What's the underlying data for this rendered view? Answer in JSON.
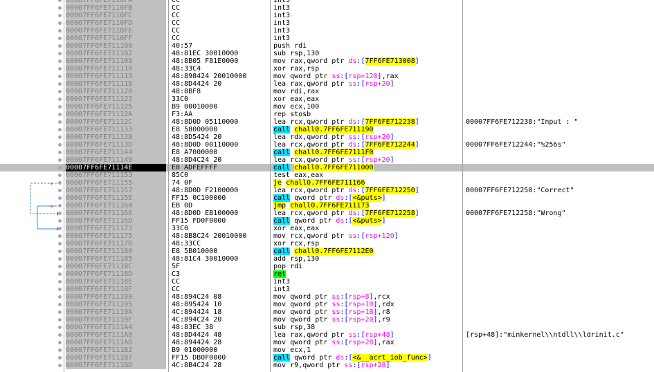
{
  "rows": [
    {
      "a": "00007FF6FE7110FA",
      "b": "CC",
      "i": [
        [
          "int3",
          ""
        ]
      ],
      "c": ""
    },
    {
      "a": "00007FF6FE7110FB",
      "b": "CC",
      "i": [
        [
          "int3",
          ""
        ]
      ],
      "c": ""
    },
    {
      "a": "00007FF6FE7110FC",
      "b": "CC",
      "i": [
        [
          "int3",
          ""
        ]
      ],
      "c": ""
    },
    {
      "a": "00007FF6FE7110FD",
      "b": "CC",
      "i": [
        [
          "int3",
          ""
        ]
      ],
      "c": ""
    },
    {
      "a": "00007FF6FE7110FE",
      "b": "CC",
      "i": [
        [
          "int3",
          ""
        ]
      ],
      "c": ""
    },
    {
      "a": "00007FF6FE7110FF",
      "b": "CC",
      "i": [
        [
          "int3",
          ""
        ]
      ],
      "c": ""
    },
    {
      "a": "00007FF6FE711100",
      "b": "40:57",
      "i": [
        [
          "push rdi",
          ""
        ]
      ],
      "c": ""
    },
    {
      "a": "00007FF6FE711102",
      "b": "48:81EC 30010000",
      "i": [
        [
          "sub rsp,130",
          ""
        ]
      ],
      "c": ""
    },
    {
      "a": "00007FF6FE711109",
      "b": "48:8B05 F81E0000",
      "i": [
        [
          "mov rax,qword ptr ",
          ""
        ],
        [
          "ds",
          "seg"
        ],
        [
          ":[",
          "bk"
        ],
        [
          "7FF6FE713008",
          "ylw"
        ],
        [
          "]",
          "bk"
        ]
      ],
      "c": ""
    },
    {
      "a": "00007FF6FE711110",
      "b": "48:33C4",
      "i": [
        [
          "xor rax,rsp",
          ""
        ]
      ],
      "c": ""
    },
    {
      "a": "00007FF6FE711113",
      "b": "48:898424 20010000",
      "i": [
        [
          "mov qword ptr ",
          ""
        ],
        [
          "ss",
          "seg"
        ],
        [
          ":[",
          "bk"
        ],
        [
          "rsp+120",
          "seg"
        ],
        [
          "]",
          "bk"
        ],
        [
          ",rax",
          ""
        ]
      ],
      "c": ""
    },
    {
      "a": "00007FF6FE71111B",
      "b": "48:8D4424 20",
      "i": [
        [
          "lea rax,qword ptr ",
          ""
        ],
        [
          "ss",
          "seg"
        ],
        [
          ":[",
          "bk"
        ],
        [
          "rsp+20",
          "seg"
        ],
        [
          "]",
          "bk"
        ]
      ],
      "c": ""
    },
    {
      "a": "00007FF6FE711120",
      "b": "48:8BF8",
      "i": [
        [
          "mov rdi,rax",
          ""
        ]
      ],
      "c": ""
    },
    {
      "a": "00007FF6FE711123",
      "b": "33C0",
      "i": [
        [
          "xor eax,eax",
          ""
        ]
      ],
      "c": ""
    },
    {
      "a": "00007FF6FE711125",
      "b": "B9 00010000",
      "i": [
        [
          "mov ecx,100",
          ""
        ]
      ],
      "c": ""
    },
    {
      "a": "00007FF6FE71112A",
      "b": "F3:AA",
      "i": [
        [
          "rep stosb",
          ""
        ]
      ],
      "c": ""
    },
    {
      "a": "00007FF6FE71112C",
      "b": "48:8D0D 05110000",
      "i": [
        [
          "lea rcx,qword ptr ",
          ""
        ],
        [
          "ds",
          "seg"
        ],
        [
          ":[",
          "bk"
        ],
        [
          "7FF6FE712238",
          "ylw"
        ],
        [
          "]",
          "bk"
        ]
      ],
      "c": "00007FF6FE712238:\"Input : \""
    },
    {
      "a": "00007FF6FE711133",
      "b": "E8 58000000",
      "i": [
        [
          "call",
          "call"
        ],
        [
          " ",
          ""
        ],
        [
          "chall0.7FF6FE711190",
          "ylw"
        ]
      ],
      "c": ""
    },
    {
      "a": "00007FF6FE711138",
      "b": "48:8D5424 20",
      "i": [
        [
          "lea rdx,qword ptr ",
          ""
        ],
        [
          "ss",
          "seg"
        ],
        [
          ":[",
          "bk"
        ],
        [
          "rsp+20",
          "seg"
        ],
        [
          "]",
          "bk"
        ]
      ],
      "c": ""
    },
    {
      "a": "00007FF6FE71113D",
      "b": "48:8D0D 00110000",
      "i": [
        [
          "lea rcx,qword ptr ",
          ""
        ],
        [
          "ds",
          "seg"
        ],
        [
          ":[",
          "bk"
        ],
        [
          "7FF6FE712244",
          "ylw"
        ],
        [
          "]",
          "bk"
        ]
      ],
      "c": "00007FF6FE712244:\"%256s\""
    },
    {
      "a": "00007FF6FE711144",
      "b": "E8 A7000000",
      "i": [
        [
          "call",
          "call"
        ],
        [
          " ",
          ""
        ],
        [
          "chall0.7FF6FE7111F0",
          "ylw"
        ]
      ],
      "c": ""
    },
    {
      "a": "00007FF6FE711149",
      "b": "48:8D4C24 20",
      "i": [
        [
          "lea rcx,qword ptr ",
          ""
        ],
        [
          "ss",
          "seg"
        ],
        [
          ":[",
          "bk"
        ],
        [
          "rsp+20",
          "seg"
        ],
        [
          "]",
          "bk"
        ]
      ],
      "c": ""
    },
    {
      "a": "00007FF6FE71114E",
      "b": "E8 ADFEFFFF",
      "i": [
        [
          "call",
          "call"
        ],
        [
          " ",
          ""
        ],
        [
          "chall0.7FF6FE711000",
          "ylw"
        ]
      ],
      "c": "",
      "sel": true
    },
    {
      "a": "00007FF6FE711153",
      "b": "85C0",
      "i": [
        [
          "test eax,eax",
          ""
        ]
      ],
      "c": ""
    },
    {
      "a": "00007FF6FE711155",
      "b": "74 0F",
      "i": [
        [
          "je",
          "jmp"
        ],
        [
          " ",
          ""
        ],
        [
          "chall0.7FF6FE711166",
          "ylw"
        ]
      ],
      "c": "",
      "fold": true
    },
    {
      "a": "00007FF6FE711157",
      "b": "48:8D0D F2100000",
      "i": [
        [
          "lea rcx,qword ptr ",
          ""
        ],
        [
          "ds",
          "seg"
        ],
        [
          ":[",
          "bk"
        ],
        [
          "7FF6FE712250",
          "ylw"
        ],
        [
          "]",
          "bk"
        ]
      ],
      "c": "00007FF6FE712250:\"Correct\""
    },
    {
      "a": "00007FF6FE71115E",
      "b": "FF15 0C100000",
      "i": [
        [
          "call",
          "call"
        ],
        [
          " qword ptr ",
          ""
        ],
        [
          "ds",
          "seg"
        ],
        [
          ":[",
          "bk"
        ],
        [
          "<&puts>",
          "ylw"
        ],
        [
          "]",
          "bk"
        ]
      ],
      "c": ""
    },
    {
      "a": "00007FF6FE711164",
      "b": "EB 0D",
      "i": [
        [
          "jmp",
          "jmp"
        ],
        [
          " ",
          ""
        ],
        [
          "chall0.7FF6FE711173",
          "ylw"
        ]
      ],
      "c": "",
      "fold": true
    },
    {
      "a": "00007FF6FE711166",
      "b": "48:8D0D EB100000",
      "i": [
        [
          "lea rcx,qword ptr ",
          ""
        ],
        [
          "ds",
          "seg"
        ],
        [
          ":[",
          "bk"
        ],
        [
          "7FF6FE712258",
          "ylw"
        ],
        [
          "]",
          "bk"
        ]
      ],
      "c": "00007FF6FE712258:\"Wrong\""
    },
    {
      "a": "00007FF6FE71116D",
      "b": "FF15 FD0F0000",
      "i": [
        [
          "call",
          "call"
        ],
        [
          " qword ptr ",
          ""
        ],
        [
          "ds",
          "seg"
        ],
        [
          ":[",
          "bk"
        ],
        [
          "<&puts>",
          "ylw"
        ],
        [
          "]",
          "bk"
        ]
      ],
      "c": ""
    },
    {
      "a": "00007FF6FE711173",
      "b": "33C0",
      "i": [
        [
          "xor eax,eax",
          ""
        ]
      ],
      "c": ""
    },
    {
      "a": "00007FF6FE711175",
      "b": "48:8B8C24 20010000",
      "i": [
        [
          "mov rcx,qword ptr ",
          ""
        ],
        [
          "ss",
          "seg"
        ],
        [
          ":[",
          "bk"
        ],
        [
          "rsp+120",
          "seg"
        ],
        [
          "]",
          "bk"
        ]
      ],
      "c": ""
    },
    {
      "a": "00007FF6FE71117D",
      "b": "48:33CC",
      "i": [
        [
          "xor rcx,rsp",
          ""
        ]
      ],
      "c": ""
    },
    {
      "a": "00007FF6FE711180",
      "b": "E8 5B010000",
      "i": [
        [
          "call",
          "call"
        ],
        [
          " ",
          ""
        ],
        [
          "chall0.7FF6FE7112E0",
          "ylw"
        ]
      ],
      "c": ""
    },
    {
      "a": "00007FF6FE711185",
      "b": "48:81C4 30010000",
      "i": [
        [
          "add rsp,130",
          ""
        ]
      ],
      "c": ""
    },
    {
      "a": "00007FF6FE71118C",
      "b": "5F",
      "i": [
        [
          "pop rdi",
          ""
        ]
      ],
      "c": ""
    },
    {
      "a": "00007FF6FE71118D",
      "b": "C3",
      "i": [
        [
          "ret",
          "ret"
        ]
      ],
      "c": ""
    },
    {
      "a": "00007FF6FE71118E",
      "b": "CC",
      "i": [
        [
          "int3",
          ""
        ]
      ],
      "c": ""
    },
    {
      "a": "00007FF6FE71118F",
      "b": "CC",
      "i": [
        [
          "int3",
          ""
        ]
      ],
      "c": ""
    },
    {
      "a": "00007FF6FE711190",
      "b": "48:894C24 08",
      "i": [
        [
          "mov qword ptr ",
          ""
        ],
        [
          "ss",
          "seg"
        ],
        [
          ":[",
          "bk"
        ],
        [
          "rsp+8",
          "seg"
        ],
        [
          "]",
          "bk"
        ],
        [
          ",rcx",
          ""
        ]
      ],
      "c": ""
    },
    {
      "a": "00007FF6FE711195",
      "b": "48:895424 10",
      "i": [
        [
          "mov qword ptr ",
          ""
        ],
        [
          "ss",
          "seg"
        ],
        [
          ":[",
          "bk"
        ],
        [
          "rsp+10",
          "seg"
        ],
        [
          "]",
          "bk"
        ],
        [
          ",rdx",
          ""
        ]
      ],
      "c": ""
    },
    {
      "a": "00007FF6FE71119A",
      "b": "4C:894424 18",
      "i": [
        [
          "mov qword ptr ",
          ""
        ],
        [
          "ss",
          "seg"
        ],
        [
          ":[",
          "bk"
        ],
        [
          "rsp+18",
          "seg"
        ],
        [
          "]",
          "bk"
        ],
        [
          ",r8",
          ""
        ]
      ],
      "c": ""
    },
    {
      "a": "00007FF6FE71119F",
      "b": "4C:894C24 20",
      "i": [
        [
          "mov qword ptr ",
          ""
        ],
        [
          "ss",
          "seg"
        ],
        [
          ":[",
          "bk"
        ],
        [
          "rsp+20",
          "seg"
        ],
        [
          "]",
          "bk"
        ],
        [
          ",r9",
          ""
        ]
      ],
      "c": ""
    },
    {
      "a": "00007FF6FE7111A4",
      "b": "48:83EC 38",
      "i": [
        [
          "sub rsp,38",
          ""
        ]
      ],
      "c": ""
    },
    {
      "a": "00007FF6FE7111A8",
      "b": "48:8D4424 48",
      "i": [
        [
          "lea rax,qword ptr ",
          ""
        ],
        [
          "ss",
          "seg"
        ],
        [
          ":[",
          "bk"
        ],
        [
          "rsp+48",
          "seg"
        ],
        [
          "]",
          "bk"
        ]
      ],
      "c": "[rsp+48]:\"minkernel\\\\ntdll\\\\ldrinit.c\""
    },
    {
      "a": "00007FF6FE7111AD",
      "b": "48:894424 28",
      "i": [
        [
          "mov qword ptr ",
          ""
        ],
        [
          "ss",
          "seg"
        ],
        [
          ":[",
          "bk"
        ],
        [
          "rsp+28",
          "seg"
        ],
        [
          "]",
          "bk"
        ],
        [
          ",rax",
          ""
        ]
      ],
      "c": ""
    },
    {
      "a": "00007FF6FE7111B2",
      "b": "B9 01000000",
      "i": [
        [
          "mov ecx,1",
          ""
        ]
      ],
      "c": ""
    },
    {
      "a": "00007FF6FE7111B7",
      "b": "FF15 DB0F0000",
      "i": [
        [
          "call",
          "call"
        ],
        [
          " qword ptr ",
          ""
        ],
        [
          "ds",
          "seg"
        ],
        [
          ":[",
          "bk"
        ],
        [
          "<&__acrt_iob_func>",
          "ylw"
        ],
        [
          "]",
          "bk"
        ]
      ],
      "c": ""
    },
    {
      "a": "00007FF6FE7111BD",
      "b": "4C:8B4C24 28",
      "i": [
        [
          "mov r9,qword ptr ",
          ""
        ],
        [
          "ss",
          "seg"
        ],
        [
          ":[",
          "bk"
        ],
        [
          "rsp+28",
          "seg"
        ],
        [
          "]",
          "bk"
        ]
      ],
      "c": ""
    }
  ],
  "colors": {
    "call": "#00e0ff",
    "jmp": "#ffff00",
    "ret": "#00ff00",
    "segment": "#ff00ff",
    "bracket": "#0000ff",
    "selection": "#c0c0c0"
  }
}
